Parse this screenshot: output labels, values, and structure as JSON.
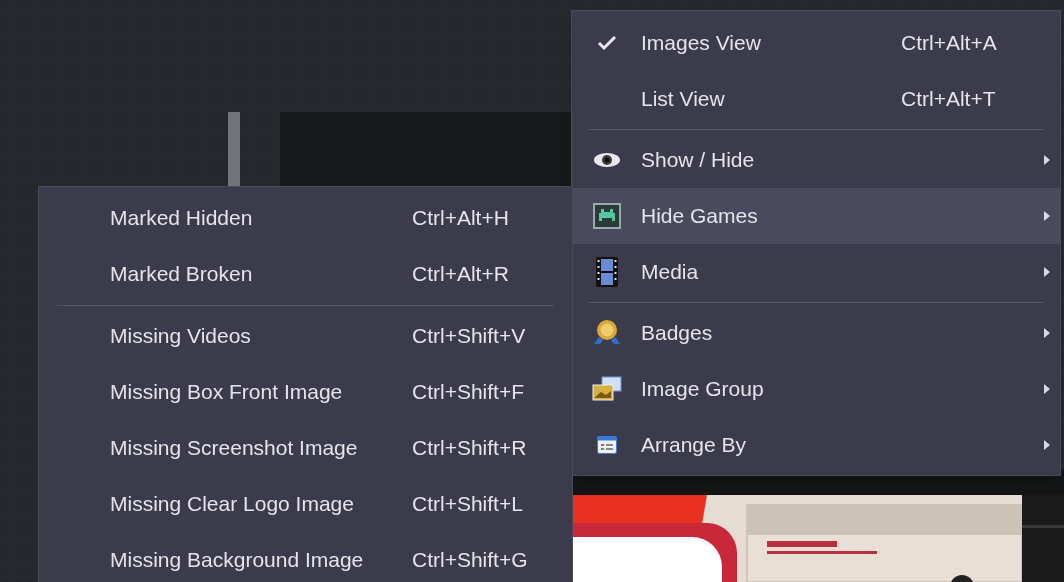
{
  "main_menu": {
    "items": [
      {
        "kind": "item",
        "label": "Images View",
        "shortcut": "Ctrl+Alt+A",
        "checked": true,
        "selected": false,
        "has_submenu": false
      },
      {
        "kind": "item",
        "label": "List View",
        "shortcut": "Ctrl+Alt+T",
        "checked": false,
        "selected": false,
        "has_submenu": false
      },
      {
        "kind": "separator"
      },
      {
        "kind": "item",
        "label": "Show / Hide",
        "checked": false,
        "selected": false,
        "has_submenu": true
      },
      {
        "kind": "item",
        "label": "Hide Games",
        "checked": false,
        "selected": true,
        "has_submenu": true
      },
      {
        "kind": "item",
        "label": "Media",
        "checked": false,
        "selected": false,
        "has_submenu": true
      },
      {
        "kind": "separator"
      },
      {
        "kind": "item",
        "label": "Badges",
        "checked": false,
        "selected": false,
        "has_submenu": true
      },
      {
        "kind": "item",
        "label": "Image Group",
        "checked": false,
        "selected": false,
        "has_submenu": true
      },
      {
        "kind": "item",
        "label": "Arrange By",
        "checked": false,
        "selected": false,
        "has_submenu": true
      }
    ]
  },
  "submenu": {
    "items": [
      {
        "kind": "item",
        "label": "Marked Hidden",
        "shortcut": "Ctrl+Alt+H"
      },
      {
        "kind": "item",
        "label": "Marked Broken",
        "shortcut": "Ctrl+Alt+R"
      },
      {
        "kind": "separator"
      },
      {
        "kind": "item",
        "label": "Missing Videos",
        "shortcut": "Ctrl+Shift+V"
      },
      {
        "kind": "item",
        "label": "Missing Box Front Image",
        "shortcut": "Ctrl+Shift+F"
      },
      {
        "kind": "item",
        "label": "Missing Screenshot Image",
        "shortcut": "Ctrl+Shift+R"
      },
      {
        "kind": "item",
        "label": "Missing Clear Logo Image",
        "shortcut": "Ctrl+Shift+L"
      },
      {
        "kind": "item",
        "label": "Missing Background Image",
        "shortcut": "Ctrl+Shift+G"
      }
    ]
  }
}
